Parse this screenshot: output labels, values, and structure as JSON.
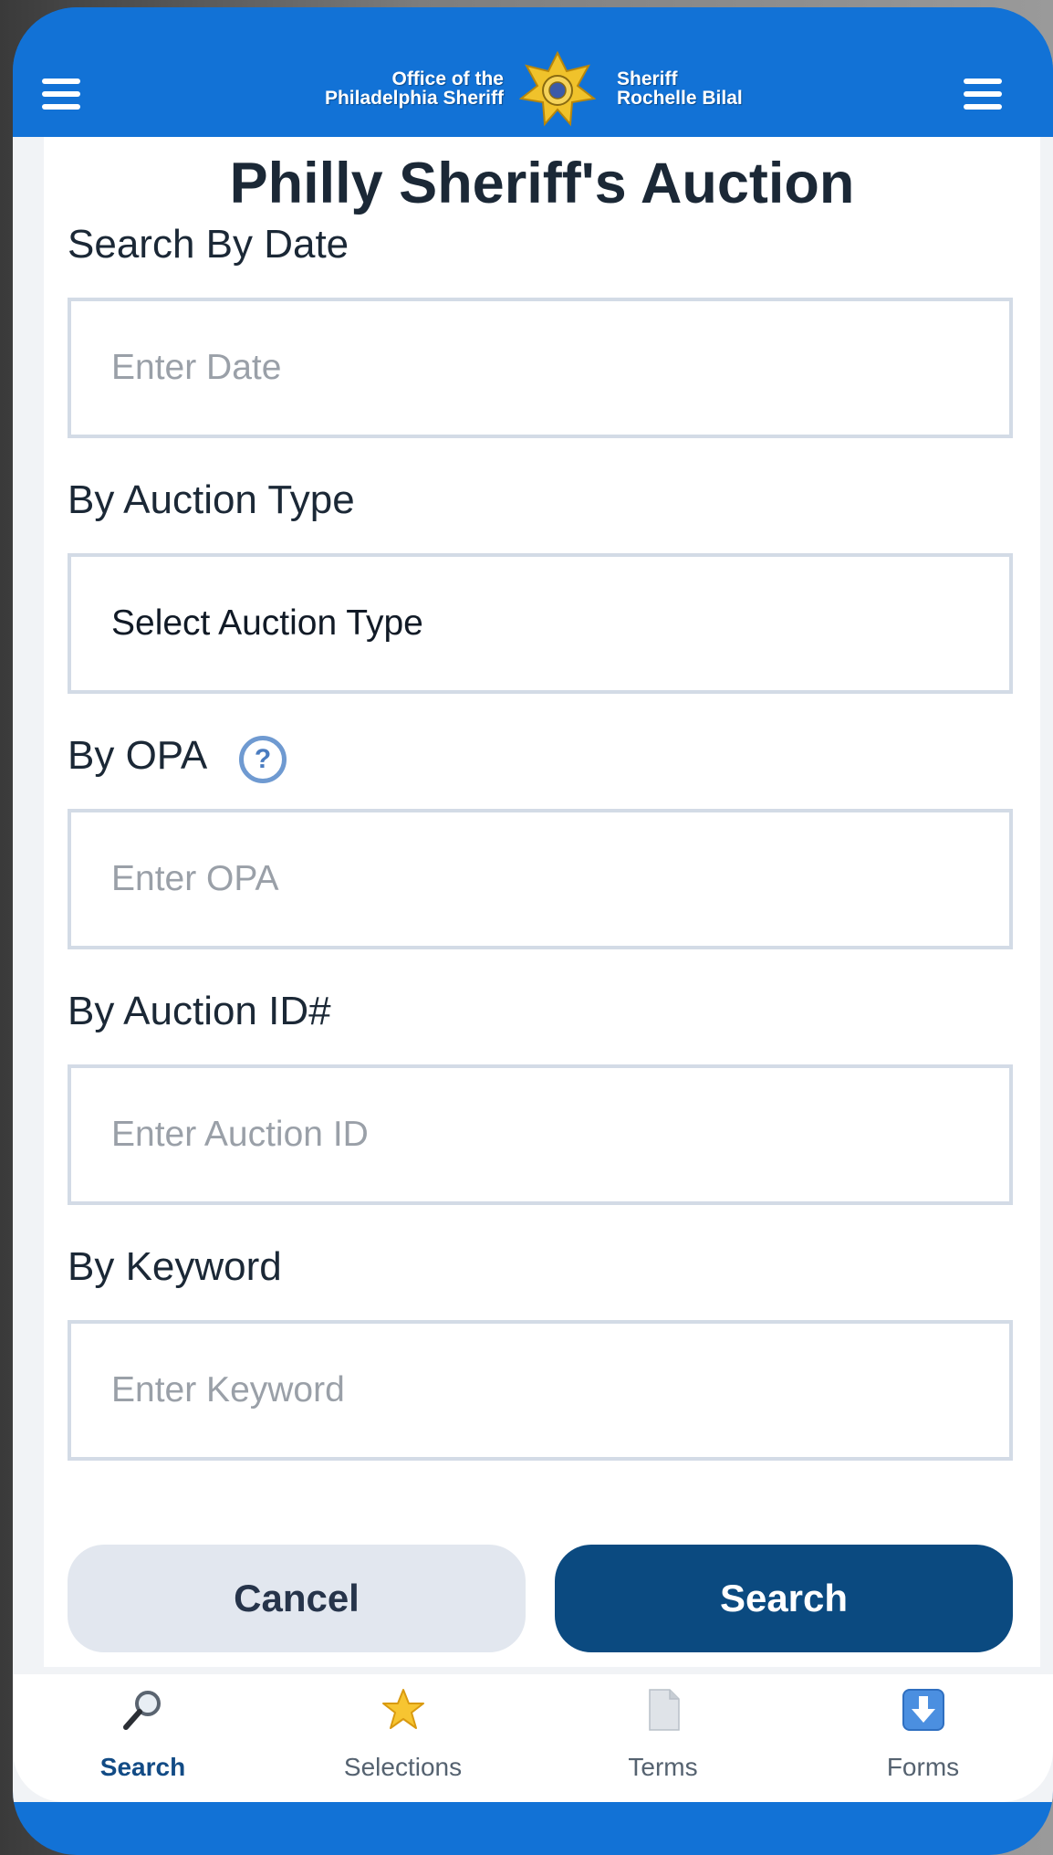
{
  "header": {
    "logo_left_line1": "Office of the",
    "logo_left_line2": "Philadelphia Sheriff",
    "logo_right_line1": "Sheriff",
    "logo_right_line2": "Rochelle Bilal",
    "left_icon": "menu-icon",
    "right_icon": "menu-icon"
  },
  "page": {
    "title": "Philly Sheriff's Auction"
  },
  "form": {
    "date": {
      "label": "Search By Date",
      "placeholder": "Enter Date"
    },
    "auction_type": {
      "label": "By Auction Type",
      "value": "Select Auction Type"
    },
    "opa": {
      "label": "By OPA",
      "help_icon": "question-icon",
      "help_glyph": "?",
      "placeholder": "Enter OPA"
    },
    "auction_id": {
      "label": "By Auction ID#",
      "placeholder": "Enter Auction ID"
    },
    "keyword": {
      "label": "By Keyword",
      "placeholder": "Enter Keyword"
    },
    "cancel_label": "Cancel",
    "search_label": "Search"
  },
  "bottom_nav": {
    "items": [
      {
        "label": "Search",
        "icon": "magnifier-icon",
        "active": true
      },
      {
        "label": "Selections",
        "icon": "star-icon",
        "active": false
      },
      {
        "label": "Terms",
        "icon": "document-icon",
        "active": false
      },
      {
        "label": "Forms",
        "icon": "download-icon",
        "active": false
      }
    ]
  },
  "colors": {
    "header_blue": "#1272d6",
    "primary_button": "#0b4a80",
    "secondary_button": "#e2e7ef",
    "input_border": "#d3dbe6",
    "active_nav": "#124b85"
  }
}
